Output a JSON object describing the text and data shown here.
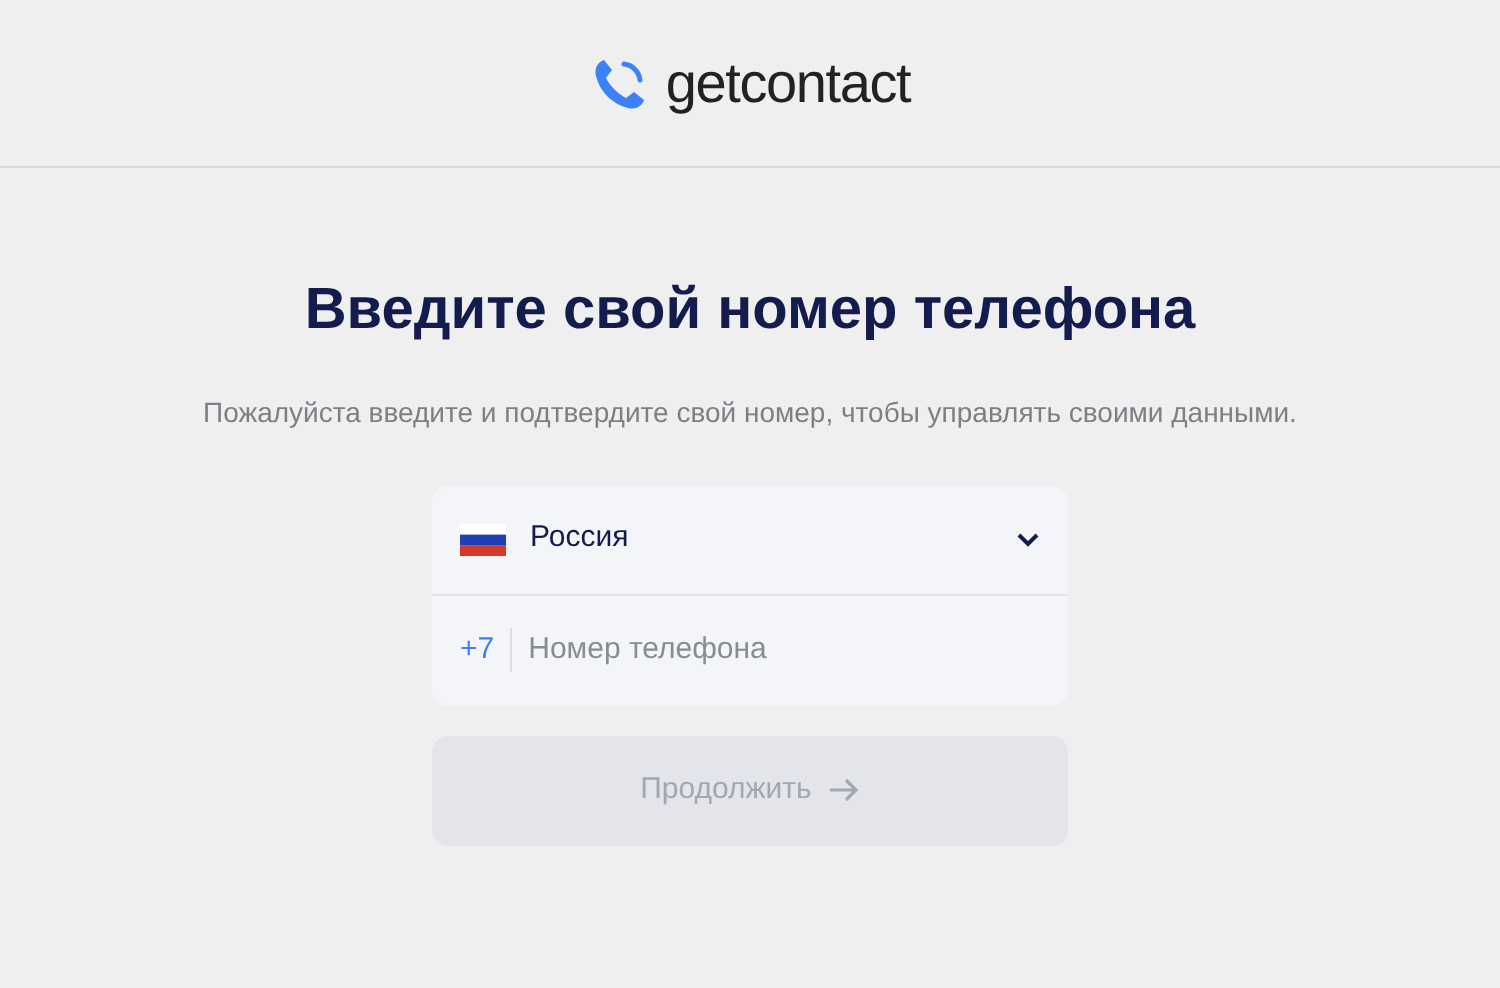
{
  "header": {
    "logo_text": "getcontact"
  },
  "title": "Введите свой номер телефона",
  "subtitle": "Пожалуйста введите и подтвердите свой номер, чтобы управлять своими данными.",
  "country_select": {
    "value": "Россия"
  },
  "phone_field": {
    "prefix": "+7",
    "placeholder": "Номер телефона"
  },
  "continue_button": {
    "label": "Продолжить",
    "disabled": true
  }
}
